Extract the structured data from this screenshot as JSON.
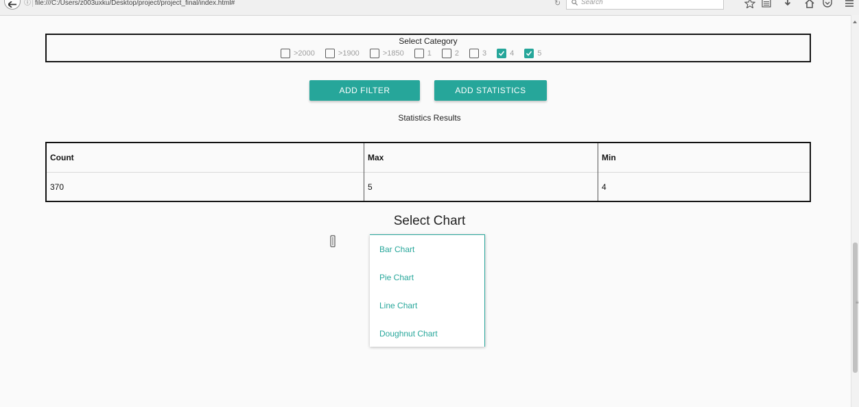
{
  "browser": {
    "url": "file:///C:/Users/z003uxku/Desktop/project/project_final/index.html#",
    "search_placeholder": "Search"
  },
  "category": {
    "title": "Select Category",
    "options": [
      {
        "label": ">2000",
        "checked": false
      },
      {
        "label": ">1900",
        "checked": false
      },
      {
        "label": ">1850",
        "checked": false
      },
      {
        "label": "1",
        "checked": false
      },
      {
        "label": "2",
        "checked": false
      },
      {
        "label": "3",
        "checked": false
      },
      {
        "label": "4",
        "checked": true
      },
      {
        "label": "5",
        "checked": true
      }
    ]
  },
  "buttons": {
    "add_filter": "ADD FILTER",
    "add_statistics": "ADD STATISTICS"
  },
  "statistics": {
    "caption": "Statistics Results",
    "headers": [
      "Count",
      "Max",
      "Min"
    ],
    "values": [
      "370",
      "5",
      "4"
    ]
  },
  "chart_select": {
    "title": "Select Chart",
    "options": [
      "Bar Chart",
      "Pie Chart",
      "Line Chart",
      "Doughnut Chart"
    ]
  },
  "colors": {
    "accent": "#26a69a"
  }
}
